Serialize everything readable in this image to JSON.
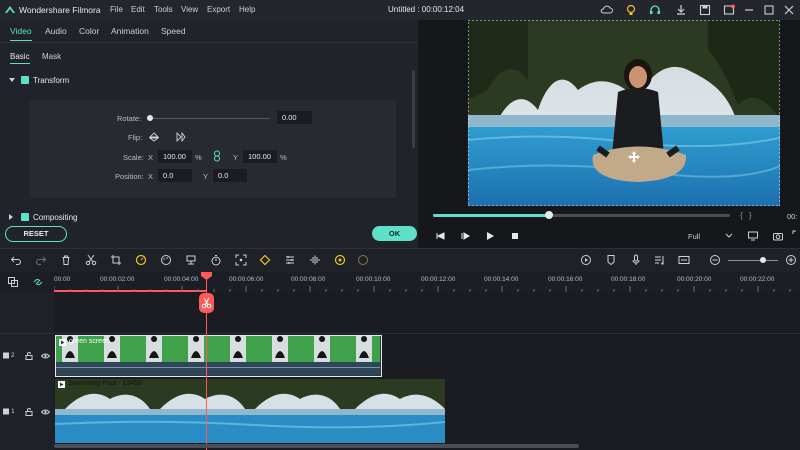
{
  "app": {
    "name": "Wondershare Filmora",
    "menu": [
      "File",
      "Edit",
      "Tools",
      "View",
      "Export",
      "Help"
    ],
    "window_title": "Untitled : 00:00:12:04"
  },
  "panel": {
    "tabs": [
      "Video",
      "Audio",
      "Color",
      "Animation",
      "Speed"
    ],
    "active_tab": "Video",
    "subtabs": [
      "Basic",
      "Mask"
    ],
    "active_subtab": "Basic",
    "transform_label": "Transform",
    "compositing_label": "Compositing",
    "rotate_label": "Rotate:",
    "rotate_value": "0.00",
    "flip_label": "Flip:",
    "scale_label": "Scale:",
    "scale_x_label": "X",
    "scale_x": "100.00",
    "scale_x_unit": "%",
    "scale_y_label": "Y",
    "scale_y": "100.00",
    "scale_y_unit": "%",
    "position_label": "Position:",
    "pos_x_label": "X",
    "pos_x": "0.0",
    "pos_y_label": "Y",
    "pos_y": "0.0",
    "reset_label": "RESET",
    "ok_label": "OK"
  },
  "player": {
    "progress": 0.39,
    "quality": "Full",
    "brackets": "{   }",
    "time_cut": "00:"
  },
  "ruler": {
    "ticks": [
      "00:00",
      "00:00:02:00",
      "00:00:04:00",
      "00:00:06:00",
      "00:00:08:00",
      "00:00:10:00",
      "00:00:12:00",
      "00:00:14:00",
      "00:00:16:00",
      "00:00:18:00",
      "00:00:20:00",
      "00:00:22:00"
    ]
  },
  "tracks": [
    {
      "track_number": "2",
      "clip_label": "green screen"
    },
    {
      "track_number": "1",
      "clip_label": "Swimming Pool - 13459"
    }
  ],
  "colors": {
    "accent": "#5fe0c8",
    "playhead": "#ff5a5a"
  }
}
